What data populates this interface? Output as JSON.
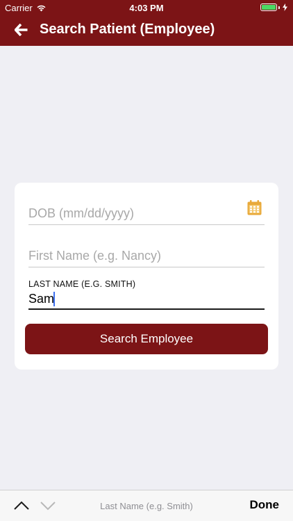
{
  "status_bar": {
    "carrier": "Carrier",
    "time": "4:03 PM",
    "battery_level": 1.0
  },
  "header": {
    "title": "Search Patient (Employee)",
    "back_icon": "arrow-left-icon",
    "background_color": "#7c1416"
  },
  "form": {
    "dob": {
      "placeholder": "DOB (mm/dd/yyyy)",
      "value": "",
      "icon": "calendar-icon"
    },
    "first_name": {
      "placeholder": "First Name (e.g. Nancy)",
      "value": ""
    },
    "last_name": {
      "label": "LAST NAME (E.G. SMITH)",
      "value": "Sam"
    },
    "search_button_label": "Search Employee"
  },
  "keyboard_toolbar": {
    "hint": "Last Name (e.g. Smith)",
    "done_label": "Done",
    "prev_icon": "chevron-up-icon",
    "next_icon": "chevron-down-icon"
  }
}
